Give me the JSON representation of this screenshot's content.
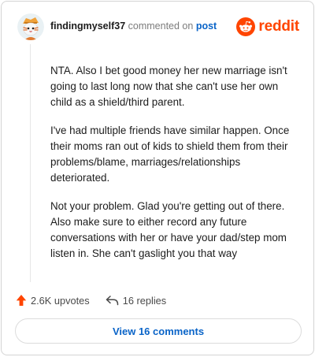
{
  "comment": {
    "username": "findingmyself37",
    "verb": "commented on",
    "target": "post",
    "paragraphs": [
      "NTA. Also I bet good money her new marriage isn't going to last long now that she can't use her own child as a shield/third parent.",
      "I've had multiple friends have similar happen. Once their moms ran out of kids to shield them from their problems/blame, marriages/relationships deteriorated.",
      "Not your problem. Glad you're getting out of there. Also make sure to either record any future conversations with her or have your dad/step mom listen in. She can't gaslight you that way"
    ]
  },
  "brand": {
    "name": "reddit",
    "color": "#ff4500",
    "icon": "reddit-snoo-icon"
  },
  "actions": {
    "upvotes_label": "2.6K upvotes",
    "replies_label": "16 replies",
    "upvote_icon": "upvote-arrow-icon",
    "reply_icon": "reply-arrow-icon"
  },
  "footer": {
    "view_comments_label": "View 16 comments"
  },
  "colors": {
    "accent_link": "#0a64c8",
    "upvote": "#ff4500",
    "muted_text": "#7c7c7c"
  }
}
